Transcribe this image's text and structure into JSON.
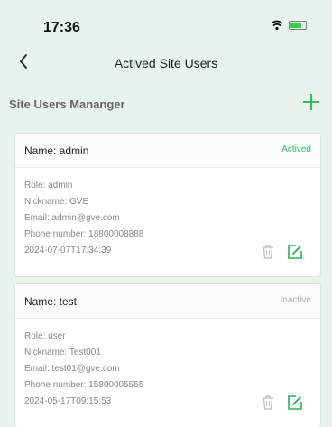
{
  "status_bar": {
    "time": "17:36"
  },
  "nav": {
    "title": "Actived Site Users"
  },
  "section": {
    "title": "Site Users Mananger"
  },
  "users": [
    {
      "name": "Name: admin",
      "status": "Actived",
      "role": "Role: admin",
      "nickname": "Nickname: GVE",
      "email": "Email: admin@gve.com",
      "phone": "Phone number: 18800008888",
      "timestamp": "2024-07-07T17:34:39"
    },
    {
      "name": "Name: test",
      "status": "Inactive",
      "role": "Role: user",
      "nickname": "Nickname: Test001",
      "email": "Email: test01@gve.com",
      "phone": "Phone number: 15800005555",
      "timestamp": "2024-05-17T09:15:53"
    }
  ],
  "colors": {
    "accent": "#25b451",
    "background": "#e8f3ec"
  },
  "icons": [
    "wifi-icon",
    "battery-icon",
    "back-icon",
    "add-icon",
    "trash-icon",
    "edit-icon"
  ]
}
